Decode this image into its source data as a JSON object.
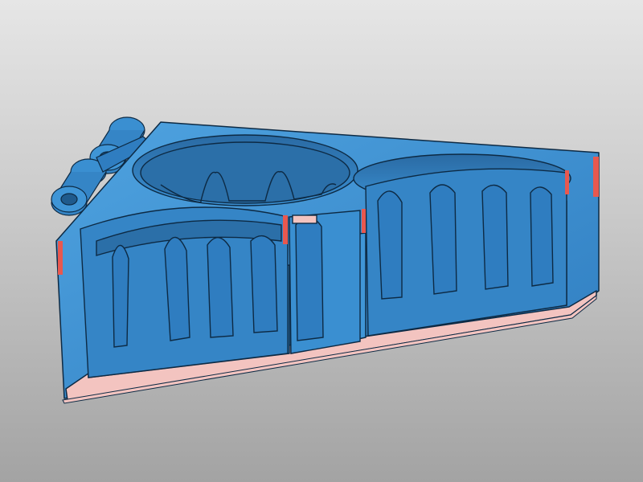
{
  "scene": {
    "background_top": "#e6e6e6",
    "background_bottom": "#a3a3a3",
    "model_color": "#3a8fd1",
    "model_shadow": "#2b6fa8",
    "cut_face_color": "#f3c4c0",
    "cut_edge_accent": "#e8584f"
  }
}
